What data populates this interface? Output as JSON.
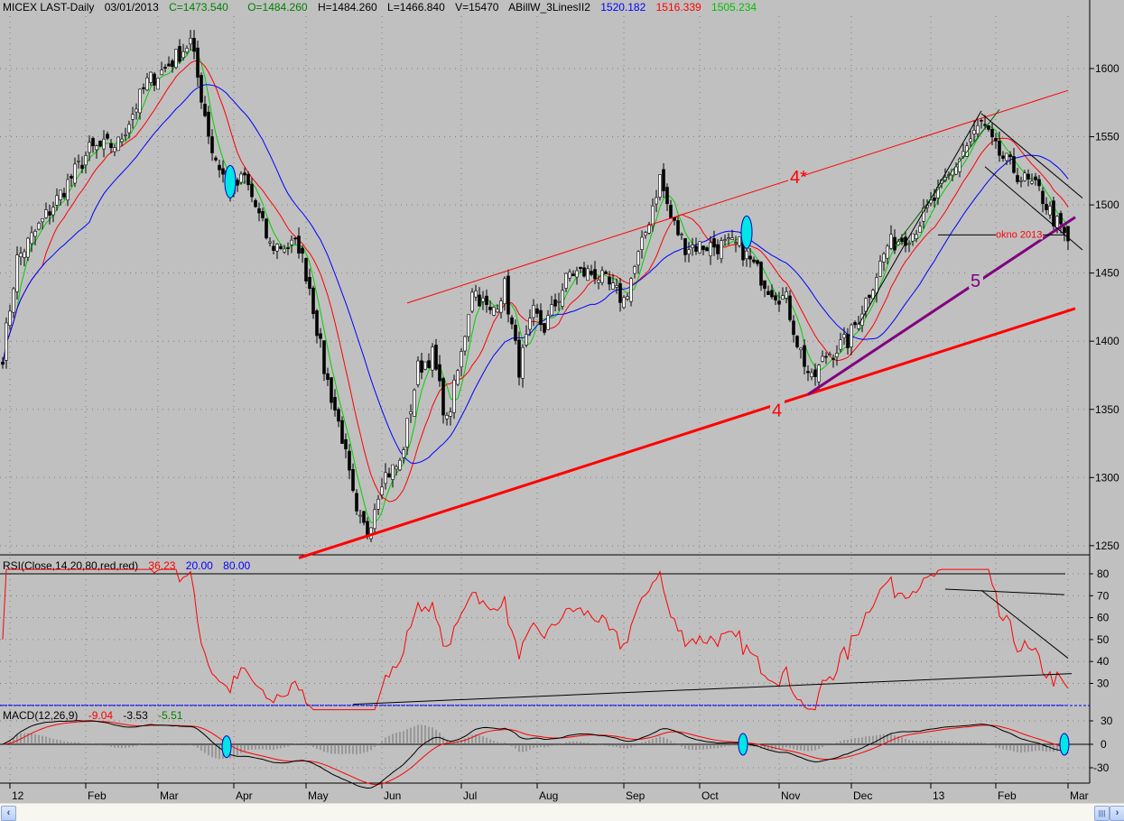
{
  "header": {
    "symbol": "MICEX LAST-Daily",
    "date": "03/01/2013",
    "close": "C=1473.540",
    "open": "O=1484.260",
    "high": "H=1484.260",
    "low": "L=1466.840",
    "volume": "V=15470",
    "indicator": "ABillW_3LinesII2",
    "ma_blue": "1520.182",
    "ma_red": "1516.339",
    "ma_green": "1505.234"
  },
  "rsi_header": {
    "label": "RSI(Close,14,20,80,red,red)",
    "value": "36.23",
    "low": "20.00",
    "high": "80.00"
  },
  "macd_header": {
    "label": "MACD(12,26,9)",
    "macd": "-9.04",
    "signal": "-3.53",
    "hist": "-5.51"
  },
  "colors": {
    "bg": "#c0c0c0",
    "green": "#00d000",
    "red": "#ff0000",
    "blue": "#0000ff",
    "purple": "#800080",
    "cyan": "#00e5e5"
  },
  "chart_data": {
    "type": "candlestick",
    "title": "MICEX LAST-Daily",
    "x_unit": "trading-day index",
    "close_keypoints": [
      [
        0,
        1390
      ],
      [
        4,
        1460
      ],
      [
        14,
        1500
      ],
      [
        24,
        1540
      ],
      [
        32,
        1545
      ],
      [
        40,
        1590
      ],
      [
        45,
        1600
      ],
      [
        52,
        1620
      ],
      [
        58,
        1540
      ],
      [
        63,
        1510
      ],
      [
        67,
        1520
      ],
      [
        74,
        1470
      ],
      [
        82,
        1470
      ],
      [
        85,
        1440
      ],
      [
        89,
        1380
      ],
      [
        94,
        1330
      ],
      [
        98,
        1270
      ],
      [
        101,
        1260
      ],
      [
        105,
        1300
      ],
      [
        110,
        1310
      ],
      [
        115,
        1380
      ],
      [
        119,
        1390
      ],
      [
        123,
        1340
      ],
      [
        127,
        1390
      ],
      [
        130,
        1440
      ],
      [
        135,
        1420
      ],
      [
        139,
        1440
      ],
      [
        143,
        1380
      ],
      [
        147,
        1420
      ],
      [
        150,
        1410
      ],
      [
        157,
        1450
      ],
      [
        164,
        1450
      ],
      [
        172,
        1430
      ],
      [
        177,
        1470
      ],
      [
        182,
        1520
      ],
      [
        185,
        1490
      ],
      [
        189,
        1470
      ],
      [
        197,
        1470
      ],
      [
        204,
        1470
      ],
      [
        212,
        1440
      ],
      [
        217,
        1430
      ],
      [
        220,
        1400
      ],
      [
        224,
        1370
      ],
      [
        228,
        1390
      ],
      [
        234,
        1400
      ],
      [
        239,
        1430
      ],
      [
        245,
        1470
      ],
      [
        252,
        1480
      ],
      [
        257,
        1500
      ],
      [
        262,
        1520
      ],
      [
        265,
        1535
      ],
      [
        271,
        1560
      ],
      [
        275,
        1540
      ],
      [
        282,
        1520
      ],
      [
        287,
        1510
      ],
      [
        291,
        1490
      ],
      [
        295,
        1473.54
      ]
    ],
    "ma_periods": {
      "green": 5,
      "red": 12,
      "blue": 25
    },
    "price_axis": {
      "min": 1235,
      "max": 1640,
      "ticks": [
        1600,
        1550,
        1500,
        1450,
        1400,
        1350,
        1300,
        1250
      ]
    },
    "rsi_axis": {
      "ticks": [
        80,
        70,
        60,
        50,
        40,
        30
      ],
      "levels": [
        20,
        80
      ],
      "period": 14
    },
    "macd_axis": {
      "ticks": [
        30,
        0,
        -30
      ],
      "params": [
        12,
        26,
        9
      ]
    },
    "months": [
      {
        "label": "12",
        "i": 2
      },
      {
        "label": "Feb",
        "i": 23
      },
      {
        "label": "Mar",
        "i": 43
      },
      {
        "label": "Apr",
        "i": 64
      },
      {
        "label": "May",
        "i": 84
      },
      {
        "label": "Jun",
        "i": 105
      },
      {
        "label": "Jul",
        "i": 127
      },
      {
        "label": "Aug",
        "i": 148
      },
      {
        "label": "Sep",
        "i": 172
      },
      {
        "label": "Oct",
        "i": 193
      },
      {
        "label": "Nov",
        "i": 215
      },
      {
        "label": "Dec",
        "i": 235
      },
      {
        "label": "13",
        "i": 257
      },
      {
        "label": "Feb",
        "i": 275
      },
      {
        "label": "Mar",
        "i": 295
      }
    ],
    "trendlines": [
      {
        "name": "trendline-4",
        "color": "#ff0000",
        "w": 3,
        "p": [
          [
            82,
            1241
          ],
          [
            297,
            1424
          ]
        ]
      },
      {
        "name": "trendline-4-star",
        "color": "#ff0000",
        "w": 1,
        "p": [
          [
            112,
            1428
          ],
          [
            295,
            1584
          ]
        ]
      },
      {
        "name": "trendline-5",
        "color": "#800080",
        "w": 3,
        "p": [
          [
            223,
            1361
          ],
          [
            297,
            1491
          ]
        ]
      },
      {
        "name": "channel-up-lower",
        "color": "#000000",
        "w": 1,
        "p": [
          [
            237,
            1412
          ],
          [
            271,
            1569
          ]
        ]
      },
      {
        "name": "channel-up-upper",
        "color": "#006000",
        "w": 1,
        "p": [
          [
            247,
            1470
          ],
          [
            276,
            1570
          ]
        ]
      },
      {
        "name": "channel-down-upper",
        "color": "#000000",
        "w": 1,
        "p": [
          [
            271,
            1567
          ],
          [
            299,
            1505
          ]
        ]
      },
      {
        "name": "channel-down-lower",
        "color": "#000000",
        "w": 1,
        "p": [
          [
            272,
            1528
          ],
          [
            299,
            1467
          ]
        ]
      },
      {
        "name": "okno-2013-line",
        "color": "#000000",
        "w": 1,
        "p": [
          [
            259,
            1478
          ],
          [
            294,
            1478
          ]
        ]
      }
    ],
    "labels": [
      {
        "text": "4*",
        "i": 218,
        "v": 1516,
        "color": "#ff0000"
      },
      {
        "text": "4",
        "i": 213,
        "v": 1345,
        "color": "#ff0000"
      },
      {
        "text": "5",
        "i": 268,
        "v": 1440,
        "color": "#800080"
      },
      {
        "text": "okno 2013",
        "i": 275,
        "v": 1476,
        "color": "#ff0000"
      }
    ],
    "rsi_lines": [
      [
        [
          97,
          20.5
        ],
        [
          296,
          34.5
        ]
      ],
      [
        [
          261,
          73
        ],
        [
          294,
          70.5
        ]
      ],
      [
        [
          271,
          72.5
        ],
        [
          295,
          41.5
        ]
      ]
    ],
    "markers": [
      {
        "panel": "price",
        "i": 63,
        "v": 1517
      },
      {
        "panel": "price",
        "i": 206,
        "v": 1480
      },
      {
        "panel": "macd",
        "i": 62,
        "v": -3
      },
      {
        "panel": "macd",
        "i": 205,
        "v": 0
      },
      {
        "panel": "macd",
        "i": 294,
        "v": 0
      }
    ]
  }
}
